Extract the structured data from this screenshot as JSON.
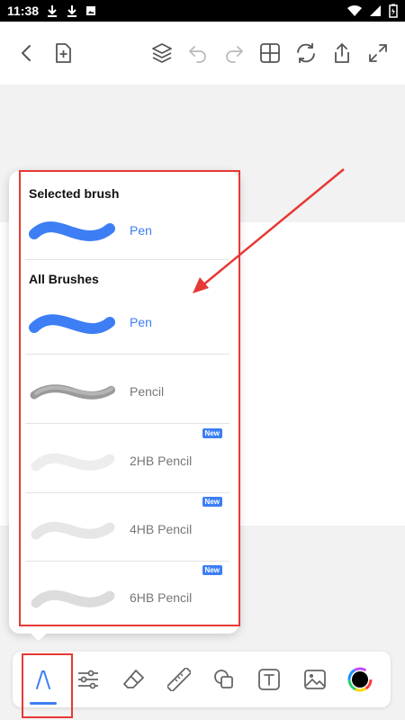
{
  "status_bar": {
    "time": "11:38"
  },
  "popup": {
    "selected_title": "Selected brush",
    "selected_brush": {
      "name": "Pen",
      "color": "#3d7ef5"
    },
    "all_title": "All Brushes",
    "brushes": [
      {
        "name": "Pen",
        "new": false,
        "color": "#3d7ef5"
      },
      {
        "name": "Pencil",
        "new": false,
        "color": "#777777"
      },
      {
        "name": "2HB Pencil",
        "new": true,
        "badge": "New",
        "color": "#777777"
      },
      {
        "name": "4HB Pencil",
        "new": true,
        "badge": "New",
        "color": "#777777"
      },
      {
        "name": "6HB Pencil",
        "new": true,
        "badge": "New",
        "color": "#777777"
      }
    ]
  },
  "toolbar": {
    "left_icons": [
      "back-icon",
      "new-page-icon"
    ],
    "right_icons": [
      "layers-icon",
      "undo-icon",
      "redo-icon",
      "grid-icon",
      "sync-icon",
      "share-icon",
      "fullscreen-icon"
    ]
  },
  "bottom_bar": {
    "tools": [
      "brush-icon",
      "adjust-icon",
      "eraser-icon",
      "ruler-icon",
      "shapes-icon",
      "text-icon",
      "image-icon",
      "color-picker-icon"
    ],
    "active": "brush-icon"
  },
  "colors": {
    "accent": "#3d7ef5",
    "annotation": "#e53935"
  }
}
